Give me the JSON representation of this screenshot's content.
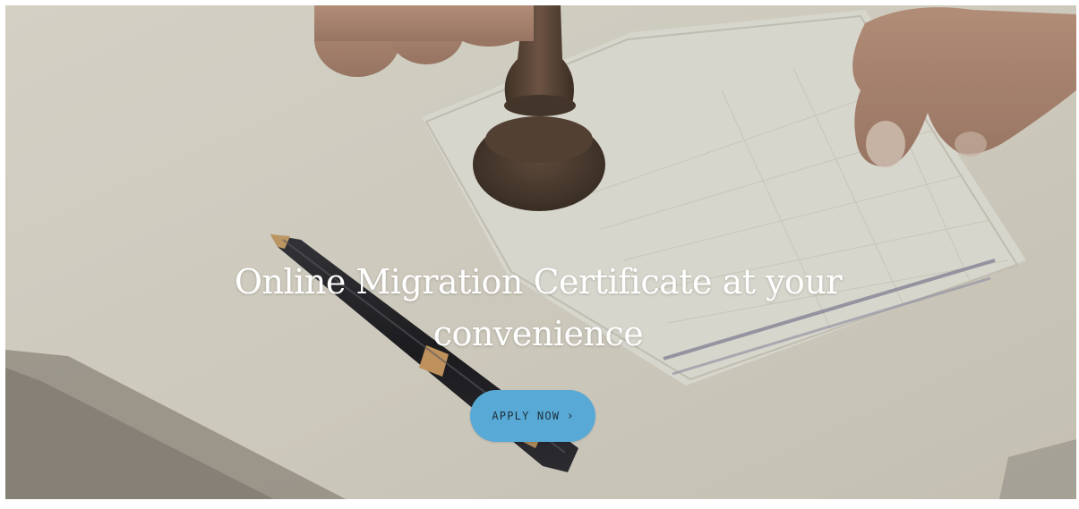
{
  "hero": {
    "title": "Online Migration Certificate at your convenience",
    "cta": {
      "label": "APPLY NOW",
      "icon": "chevron-right-icon",
      "icon_glyph": "›",
      "color": "#58a9d6"
    }
  }
}
